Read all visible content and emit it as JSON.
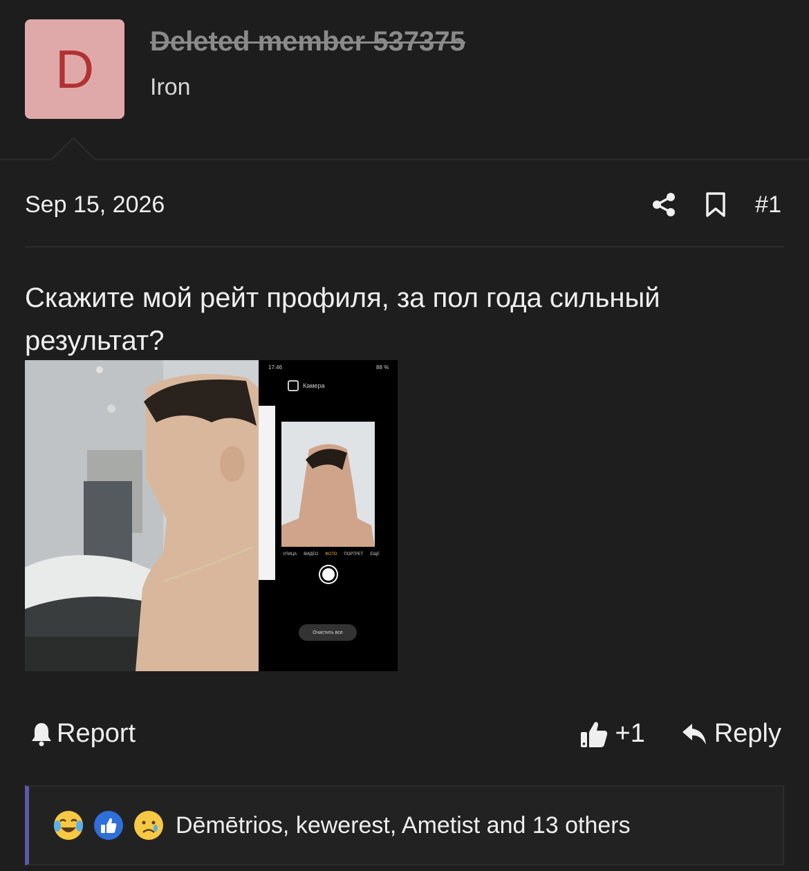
{
  "author": {
    "avatar_letter": "D",
    "avatar_bg": "#e0a9a9",
    "avatar_fg": "#b03232",
    "name": "Deleted member 537375",
    "title": "Iron"
  },
  "post": {
    "date": "Sep 15, 2026",
    "number": "#1",
    "text": "Скажите мой рейт профиля, за пол года сильный результат?",
    "actions": {
      "share_icon": "share-icon",
      "bookmark_icon": "bookmark-icon"
    }
  },
  "attachment": {
    "phone_time": "17:46",
    "phone_battery": "88 %",
    "app_title": "Камера",
    "modes": [
      "УЛИЦА",
      "ВИДЕО",
      "ФОТО",
      "ПОРТРЕТ",
      "ЕЩЕ"
    ],
    "clear_all": "Очистить все"
  },
  "footer": {
    "report_label": "Report",
    "like_count": "+1",
    "reply_label": "Reply"
  },
  "reactions": {
    "icons": [
      "crying-laughing-emoji",
      "thumbs-up-emoji",
      "sad-tear-emoji"
    ],
    "summary": "Dēmētrios, kewerest, Ametist and 13 others",
    "accent": "#5a5aa8"
  }
}
